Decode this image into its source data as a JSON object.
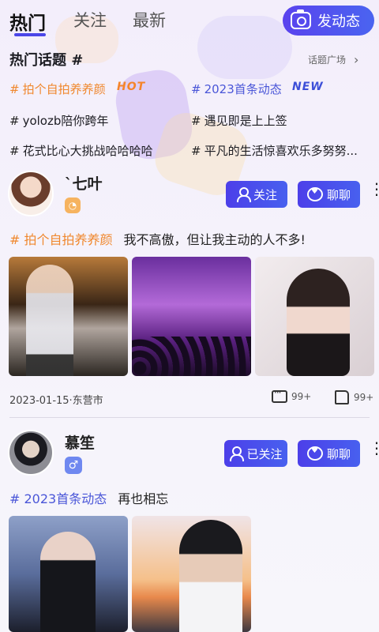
{
  "tabs": [
    {
      "label": "热门",
      "active": true
    },
    {
      "label": "关注",
      "active": false
    },
    {
      "label": "最新",
      "active": false
    }
  ],
  "post_button": {
    "label": "发动态",
    "icon": "camera-icon"
  },
  "hot_topics": {
    "title": "热门话题 #",
    "more_label": "话题广场",
    "items": [
      {
        "hash": "#",
        "text": "拍个自拍养养颜",
        "badge": "HOT",
        "color": "#f0882e"
      },
      {
        "hash": "#",
        "text": "2023首条动态",
        "badge": "NEW",
        "color": "#4a56d8"
      },
      {
        "hash": "#",
        "text": "yolozb陪你跨年"
      },
      {
        "hash": "#",
        "text": "遇见即是上上签"
      },
      {
        "hash": "#",
        "text": "花式比心大挑战哈哈哈哈"
      },
      {
        "hash": "#",
        "text": "平凡的生活惊喜欢乐多努努..."
      }
    ]
  },
  "posts": [
    {
      "username": "`七叶",
      "gender": "female",
      "follow_label": "关注",
      "chat_label": "聊聊",
      "topic": "# 拍个自拍养养颜",
      "topic_color": "#f0882e",
      "text": "我不高傲，但让我主动的人不多!",
      "date_location": "2023-01-15·东营市",
      "comments": "99+",
      "likes": "99+"
    },
    {
      "username": "慕笙",
      "gender": "male",
      "follow_label": "已关注",
      "chat_label": "聊聊",
      "topic": "# 2023首条动态",
      "topic_color": "#4a56d8",
      "text": "再也相忘"
    }
  ],
  "colors": {
    "accent": "#4b46e8",
    "hot": "#f0882e",
    "new": "#3d4fd8"
  }
}
